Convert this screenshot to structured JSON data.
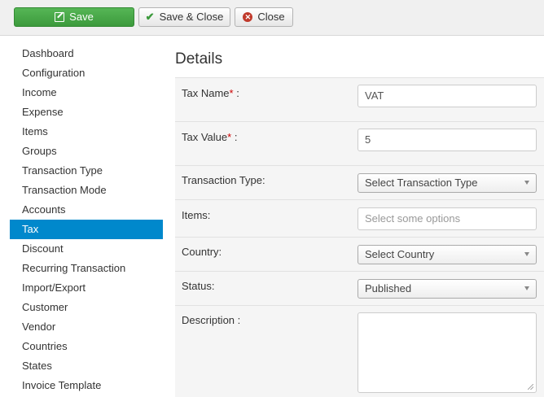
{
  "toolbar": {
    "save_label": "Save",
    "save_close_label": "Save & Close",
    "close_label": "Close"
  },
  "sidebar": {
    "items": [
      {
        "label": "Dashboard"
      },
      {
        "label": "Configuration"
      },
      {
        "label": "Income"
      },
      {
        "label": "Expense"
      },
      {
        "label": "Items"
      },
      {
        "label": "Groups"
      },
      {
        "label": "Transaction Type"
      },
      {
        "label": "Transaction Mode"
      },
      {
        "label": "Accounts"
      },
      {
        "label": "Tax",
        "active": true
      },
      {
        "label": "Discount"
      },
      {
        "label": "Recurring Transaction"
      },
      {
        "label": "Import/Export"
      },
      {
        "label": "Customer"
      },
      {
        "label": "Vendor"
      },
      {
        "label": "Countries"
      },
      {
        "label": "States"
      },
      {
        "label": "Invoice Template"
      }
    ]
  },
  "main": {
    "heading": "Details",
    "form": {
      "tax_name": {
        "label": "Tax Name",
        "required_mark": "*",
        "suffix": " :",
        "value": "VAT"
      },
      "tax_value": {
        "label": "Tax Value",
        "required_mark": "*",
        "suffix": " :",
        "value": "5"
      },
      "transaction_type": {
        "label": "Transaction Type:",
        "selected": "Select Transaction Type"
      },
      "items": {
        "label": "Items:",
        "placeholder": "Select some options"
      },
      "country": {
        "label": "Country:",
        "selected": "Select Country"
      },
      "status": {
        "label": "Status:",
        "selected": "Published"
      },
      "description": {
        "label": "Description :",
        "value": ""
      }
    }
  },
  "colors": {
    "save_green": "#3c9a3c",
    "active_blue": "#0088cc",
    "required_red": "#cc0000",
    "close_red": "#c0392b"
  },
  "icons": {
    "save": "edit-icon",
    "save_close": "check-icon",
    "close": "close-circle-icon",
    "select": "chevron-down-icon"
  }
}
